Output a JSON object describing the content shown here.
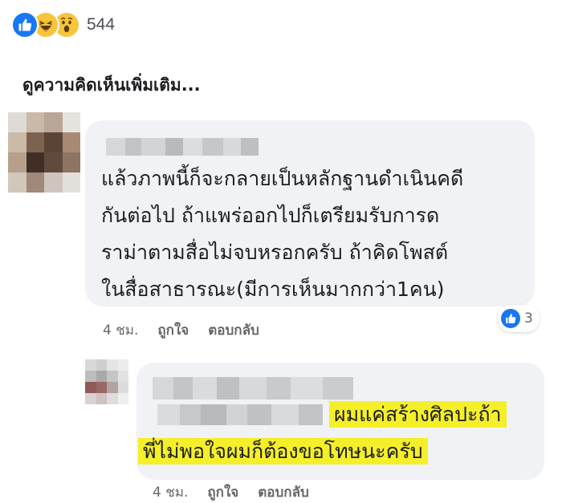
{
  "post": {
    "reactions": {
      "icons": [
        "like-icon",
        "haha-icon",
        "wow-icon"
      ],
      "count": "544"
    },
    "more_comments_label": "ดูความคิดเห็นเพิ่มเติม..."
  },
  "comments": [
    {
      "author_name": "",
      "lines": [
        "แล้วภาพนี้ก็จะกลายเป็นหลักฐานดำเนินคดี",
        "กันต่อไป  ถ้าแพร่ออกไปก็เตรียมรับการด",
        "ราม่าตามสื่อไม่จบหรอกครับ  ถ้าคิดโพสต์",
        "ในสื่อสาธารณะ(มีการเห็นมากกว่า1คน)"
      ],
      "time": "4 ชม.",
      "like_label": "ถูกใจ",
      "reply_label": "ตอบกลับ",
      "reaction_count": "3"
    },
    {
      "author_name": "",
      "highlight_lines": [
        "ผมแค่สร้างศิลปะถ้า",
        "พี่ไม่พอใจผมก็ต้องขอโทษนะครับ"
      ],
      "time": "4 ชม.",
      "like_label": "ถูกใจ",
      "reply_label": "ตอบกลับ"
    }
  ],
  "colors": {
    "like_blue": "#1877f2",
    "bubble_gray": "#f0f2f5",
    "highlight_yellow": "#f5ef2a",
    "meta_gray": "#65676b"
  }
}
